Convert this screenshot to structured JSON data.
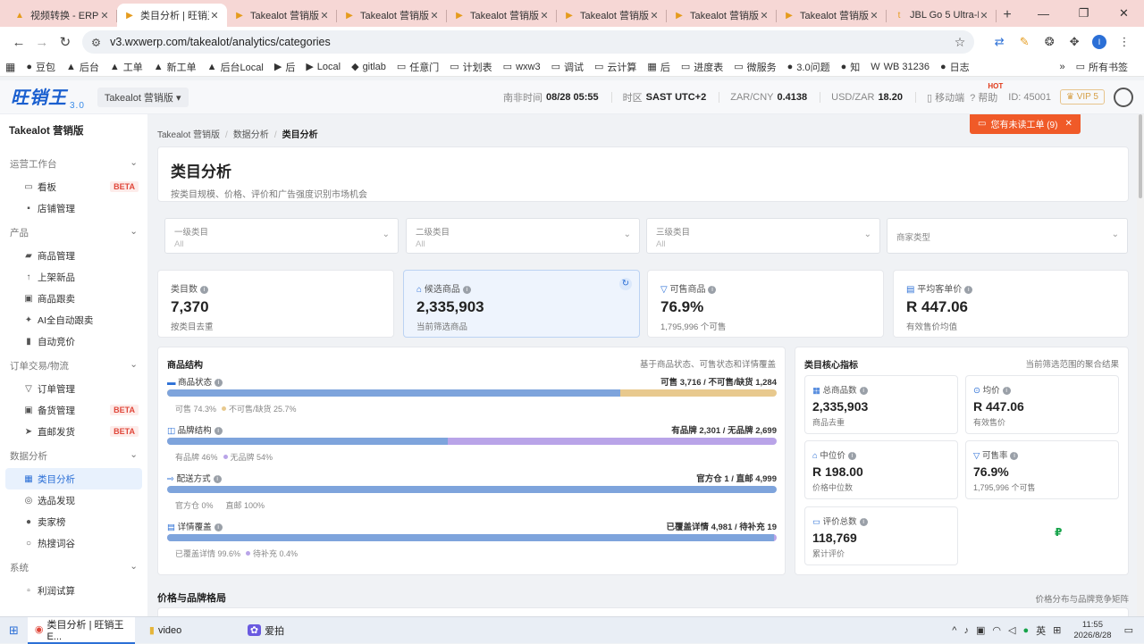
{
  "browser": {
    "tabs": [
      {
        "title": "视频转换 - ERP 系",
        "active": false
      },
      {
        "title": "类目分析 | 旺销王",
        "active": true
      },
      {
        "title": "Takealot 营销版",
        "active": false
      },
      {
        "title": "Takealot 营销版",
        "active": false
      },
      {
        "title": "Takealot 营销版",
        "active": false
      },
      {
        "title": "Takealot 营销版",
        "active": false
      },
      {
        "title": "Takealot 营销版",
        "active": false
      },
      {
        "title": "Takealot 营销版",
        "active": false
      },
      {
        "title": "JBL Go 5 Ultra-P",
        "active": false
      }
    ],
    "url": "v3.wxwerp.com/takealot/analytics/categories",
    "bookmarks": [
      "豆包",
      "后台",
      "工单",
      "新工单",
      "后台Local",
      "后",
      "Local",
      "gitlab",
      "任意门",
      "计划表",
      "wxw3",
      "调试",
      "云计算",
      "后",
      "进度表",
      "微服务",
      "3.0问题",
      "知",
      "WB 31236",
      "日志"
    ],
    "bookmarks_all": "所有书签"
  },
  "header": {
    "logo": "旺销王",
    "logo_ver": "3.0",
    "shop": "Takealot 营销版",
    "time_label": "南非时间",
    "time_value": "08/28 05:55",
    "tz_label": "时区",
    "tz_value": "SAST UTC+2",
    "zarcny_label": "ZAR/CNY",
    "zarcny_value": "0.4138",
    "usdzar_label": "USD/ZAR",
    "usdzar_value": "18.20",
    "mobile": "移动端",
    "hot": "HOT",
    "help": "帮助",
    "id": "ID: 45001",
    "vip": "VIP 5"
  },
  "sidebar": {
    "brand": "Takealot 营销版",
    "groups": [
      {
        "label": "运营工作台",
        "items": [
          {
            "label": "看板",
            "icon": "monitor-icon",
            "glyph": "▭",
            "badge": "BETA"
          },
          {
            "label": "店铺管理",
            "icon": "store-icon",
            "glyph": "▪"
          }
        ]
      },
      {
        "label": "产品",
        "items": [
          {
            "label": "商品管理",
            "icon": "bag-icon",
            "glyph": "▰"
          },
          {
            "label": "上架新品",
            "icon": "upload-icon",
            "glyph": "↑"
          },
          {
            "label": "商品跟卖",
            "icon": "tag-icon",
            "glyph": "▣"
          },
          {
            "label": "AI全自动跟卖",
            "icon": "sparkle-icon",
            "glyph": "✦"
          },
          {
            "label": "自动竞价",
            "icon": "bar-chart-icon",
            "glyph": "▮"
          }
        ]
      },
      {
        "label": "订单交易/物流",
        "items": [
          {
            "label": "订单管理",
            "icon": "cart-icon",
            "glyph": "▽"
          },
          {
            "label": "备货管理",
            "icon": "box-icon",
            "glyph": "▣",
            "badge": "BETA"
          },
          {
            "label": "直邮发货",
            "icon": "send-icon",
            "glyph": "➤",
            "badge": "BETA"
          }
        ]
      },
      {
        "label": "数据分析",
        "items": [
          {
            "label": "类目分析",
            "icon": "grid-icon",
            "glyph": "▦",
            "active": true
          },
          {
            "label": "选品发现",
            "icon": "compass-icon",
            "glyph": "◎"
          },
          {
            "label": "卖家榜",
            "icon": "user-icon",
            "glyph": "●"
          },
          {
            "label": "热搜词谷",
            "icon": "search-icon",
            "glyph": "○"
          }
        ]
      },
      {
        "label": "系统",
        "items": [
          {
            "label": "利润试算",
            "icon": "calc-icon",
            "glyph": "▫"
          }
        ]
      }
    ]
  },
  "breadcrumb": [
    "Takealot 营销版",
    "数据分析",
    "类目分析"
  ],
  "toast": "您有未读工单 (9)",
  "page": {
    "title": "类目分析",
    "subtitle": "按类目规模、价格、评价和广告强度识别市场机会"
  },
  "filters": [
    {
      "label": "一级类目",
      "value": "All"
    },
    {
      "label": "二级类目",
      "value": "All"
    },
    {
      "label": "三级类目",
      "value": "All"
    },
    {
      "label": "商家类型",
      "value": ""
    }
  ],
  "kpis": [
    {
      "label": "类目数",
      "value": "7,370",
      "sub": "按类目去重"
    },
    {
      "label": "候选商品",
      "value": "2,335,903",
      "sub": "当前筛选商品"
    },
    {
      "label": "可售商品",
      "value": "76.9%",
      "sub": "1,795,996 个可售"
    },
    {
      "label": "平均客单价",
      "value": "R 447.06",
      "sub": "有效售价均值"
    }
  ],
  "structure": {
    "title": "商品结构",
    "right": "基于商品状态、可售状态和详情覆盖",
    "rows": [
      {
        "label": "商品状态",
        "summary": "可售 3,716 / 不可售/缺货 1,284",
        "fill": 0.743,
        "leg_a": "可售 74.3%",
        "leg_b": "不可售/缺货 25.7%",
        "color_a": "#7ea4dc",
        "color_b": "#e8c98e"
      },
      {
        "label": "品牌结构",
        "summary": "有品牌 2,301 / 无品牌 2,699",
        "fill": 0.46,
        "leg_a": "有品牌 46%",
        "leg_b": "无品牌 54%",
        "color_a": "#7ea4dc",
        "color_b": "#b9a4e8"
      },
      {
        "label": "配送方式",
        "summary": "官方仓 1 / 直邮 4,999",
        "fill": 0.0,
        "leg_a": "官方仓 0%",
        "leg_b": "直邮 100%",
        "color_a": "#7ea4dc",
        "color_b": "#7ea4dc"
      },
      {
        "label": "详情覆盖",
        "summary": "已覆盖详情 4,981 / 待补充 19",
        "fill": 0.996,
        "leg_a": "已覆盖详情 99.6%",
        "leg_b": "待补充 0.4%",
        "color_a": "#7ea4dc",
        "color_b": "#b9a4e8"
      }
    ]
  },
  "core": {
    "title": "类目核心指标",
    "right": "当前筛选范围的聚合结果",
    "metrics": [
      {
        "label": "总商品数",
        "value": "2,335,903",
        "sub": "商品去重"
      },
      {
        "label": "均价",
        "value": "R 447.06",
        "sub": "有效售价"
      },
      {
        "label": "中位价",
        "value": "R 198.00",
        "sub": "价格中位数"
      },
      {
        "label": "可售率",
        "value": "76.9%",
        "sub": "1,795,996 个可售"
      },
      {
        "label": "评价总数",
        "value": "118,769",
        "sub": "累计评价"
      }
    ]
  },
  "section2": {
    "title": "价格与品牌格局",
    "right": "价格分布与品牌竞争矩阵"
  },
  "taskbar": {
    "items": [
      "类目分析 | 旺销王E...",
      "video",
      "爱拍"
    ],
    "ime": "英",
    "time": "11:55",
    "date": "2026/8/28"
  }
}
